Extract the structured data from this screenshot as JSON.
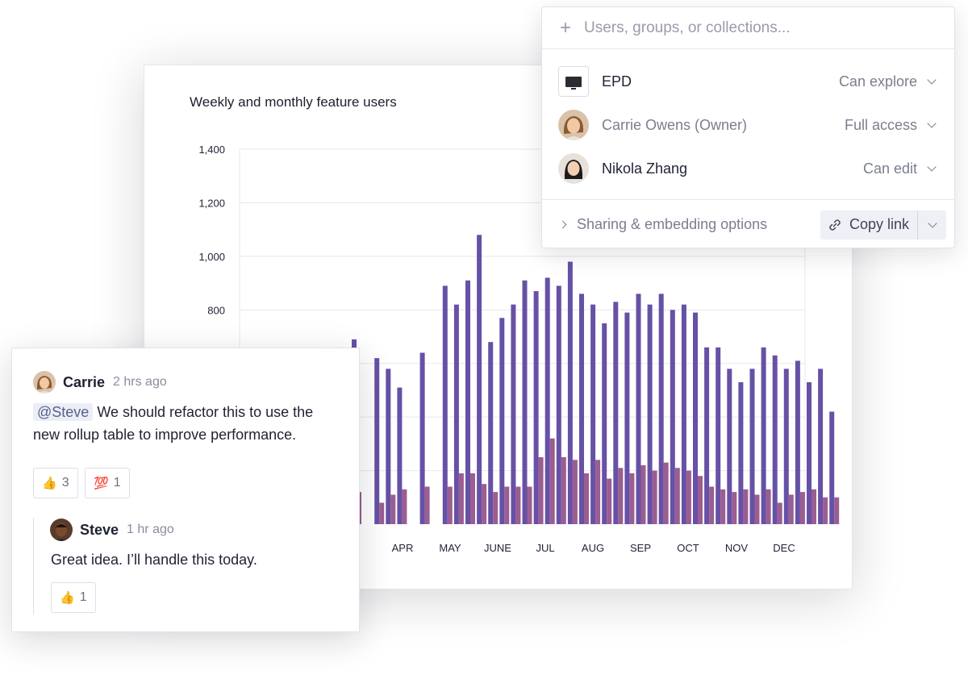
{
  "chart": {
    "title": "Weekly and monthly feature users",
    "y_ticks": [
      "1,400",
      "1,200",
      "1,000",
      "800"
    ],
    "x_ticks": [
      "R",
      "APR",
      "MAY",
      "JUNE",
      "JUL",
      "AUG",
      "SEP",
      "OCT",
      "NOV",
      "DEC"
    ],
    "colors": {
      "weekly": "#6651a6",
      "monthly": "#9b5e91",
      "grid": "#e8e8ec"
    }
  },
  "chart_data": {
    "type": "bar",
    "ylim": [
      0,
      1400
    ],
    "x_tick_labels": [
      "APR",
      "MAY",
      "JUNE",
      "JUL",
      "AUG",
      "SEP",
      "OCT",
      "NOV",
      "DEC"
    ],
    "series": [
      {
        "values": [
          690,
          0,
          620,
          580,
          510,
          0,
          640,
          0,
          890,
          820,
          910,
          1080,
          680,
          770,
          820,
          910,
          870,
          920,
          890,
          980,
          860,
          820,
          750,
          830,
          790,
          860,
          820,
          860,
          800,
          820,
          790,
          660,
          660,
          580,
          530,
          580,
          660,
          630,
          580,
          610,
          530,
          580,
          420
        ]
      },
      {
        "values": [
          120,
          0,
          80,
          110,
          130,
          0,
          140,
          0,
          140,
          190,
          190,
          150,
          120,
          140,
          140,
          140,
          250,
          320,
          250,
          240,
          190,
          240,
          170,
          210,
          190,
          220,
          200,
          230,
          210,
          200,
          180,
          140,
          130,
          120,
          130,
          110,
          130,
          80,
          110,
          120,
          130,
          100,
          100
        ]
      }
    ]
  },
  "share": {
    "search_placeholder": "Users, groups, or collections...",
    "rows": [
      {
        "name": "EPD",
        "permission": "Can explore"
      },
      {
        "name": "Carrie Owens (Owner)",
        "permission": "Full access"
      },
      {
        "name": "Nikola Zhang",
        "permission": "Can edit"
      }
    ],
    "options_label": "Sharing & embedding options",
    "copy_link_label": "Copy link"
  },
  "comments": {
    "first": {
      "author": "Carrie",
      "time": "2 hrs ago",
      "mention": "@Steve",
      "text_part1": " We should refactor this to use the",
      "text_part2": "new rollup table to improve performance.",
      "reactions": [
        {
          "emoji": "👍",
          "count": "3"
        },
        {
          "emoji": "💯",
          "count": "1"
        }
      ]
    },
    "reply": {
      "author": "Steve",
      "time": "1 hr ago",
      "text": "Great idea. I’ll handle this today.",
      "reactions": [
        {
          "emoji": "👍",
          "count": "1"
        }
      ]
    }
  }
}
